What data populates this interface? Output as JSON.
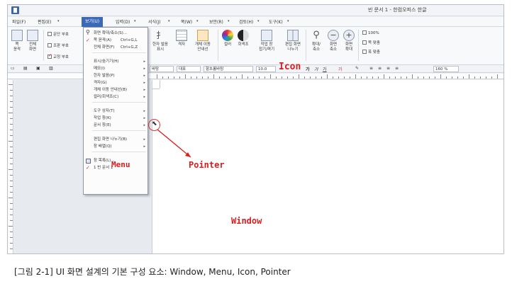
{
  "window": {
    "title": "빈 문서 1 - 한컴오피스 한글"
  },
  "menubar": {
    "items": [
      {
        "label": "파일(F)"
      },
      {
        "label": "편집(E)"
      },
      {
        "label": "보기(U)"
      },
      {
        "label": "입력(D)"
      },
      {
        "label": "서식(J)"
      },
      {
        "label": "쪽(W)"
      },
      {
        "label": "보안(R)"
      },
      {
        "label": "검토(H)"
      },
      {
        "label": "도구(K)"
      }
    ]
  },
  "ribbon": {
    "buttons": [
      {
        "label": "쪽\n윤곽"
      },
      {
        "label": "전체\n화면"
      },
      {
        "label": "한자 발음\n표시"
      },
      {
        "label": "격자"
      },
      {
        "label": "개체 이동\n안내선"
      },
      {
        "label": "컬러"
      },
      {
        "label": "회색조"
      },
      {
        "label": "작업 창\n접기/펴기"
      },
      {
        "label": "편집 화면\n나누기"
      },
      {
        "label": "확대/\n축소"
      },
      {
        "label": "화면\n축소"
      },
      {
        "label": "화면\n확대"
      }
    ],
    "checks": [
      {
        "label": "문단 부호",
        "checked": false
      },
      {
        "label": "조판 부호",
        "checked": false
      },
      {
        "label": "교정 부호",
        "checked": true
      }
    ],
    "zoom_options": [
      "100%",
      "쪽 맞춤",
      "폭 맞춤"
    ]
  },
  "formatbar": {
    "style": "바탕",
    "lang": "대표",
    "font": "함초롬바탕",
    "size": "10.0",
    "zoom": "160 %"
  },
  "dropdown": {
    "items": [
      {
        "label": "화면 확대/축소(S)...",
        "shortcut": "",
        "submenu": false,
        "icon": "zoom-icon"
      },
      {
        "label": "쪽 윤곽(A)",
        "shortcut": "Ctrl+G,L",
        "submenu": false,
        "icon": "check-icon"
      },
      {
        "label": "전체 화면(F)",
        "shortcut": "Ctrl+G,Z",
        "submenu": false,
        "icon": ""
      },
      {
        "label": "표시/숨기기(H)",
        "shortcut": "",
        "submenu": true,
        "icon": ""
      },
      {
        "label": "메모(I)",
        "shortcut": "",
        "submenu": true,
        "icon": ""
      },
      {
        "label": "한자 발음(P)",
        "shortcut": "",
        "submenu": true,
        "icon": ""
      },
      {
        "label": "격자(G)",
        "shortcut": "",
        "submenu": true,
        "icon": ""
      },
      {
        "label": "개체 이동 안내선(B)",
        "shortcut": "",
        "submenu": true,
        "icon": ""
      },
      {
        "label": "컬러/회색조(C)",
        "shortcut": "",
        "submenu": true,
        "icon": ""
      },
      {
        "label": "도구 상자(T)",
        "shortcut": "",
        "submenu": true,
        "icon": ""
      },
      {
        "label": "작업 창(K)",
        "shortcut": "",
        "submenu": true,
        "icon": ""
      },
      {
        "label": "문서 창(E)",
        "shortcut": "",
        "submenu": true,
        "icon": ""
      },
      {
        "label": "편집 화면 나누기(B)",
        "shortcut": "",
        "submenu": true,
        "icon": ""
      },
      {
        "label": "창 배열(Q)",
        "shortcut": "",
        "submenu": true,
        "icon": ""
      },
      {
        "label": "창 목록(L)...",
        "shortcut": "",
        "submenu": false,
        "icon": "window-list-icon"
      },
      {
        "label": "1 빈 문서 1",
        "shortcut": "",
        "submenu": false,
        "icon": "check-icon"
      }
    ]
  },
  "annotations": {
    "icon": "Icon",
    "menu": "Menu",
    "pointer": "Pointer",
    "window": "Window"
  },
  "caption": "[그림 2-1] UI 화면 설계의 기본 구성 요소: Window, Menu, Icon, Pointer",
  "colors": {
    "accent": "#3b69b8",
    "annotation": "#d81e1e"
  }
}
